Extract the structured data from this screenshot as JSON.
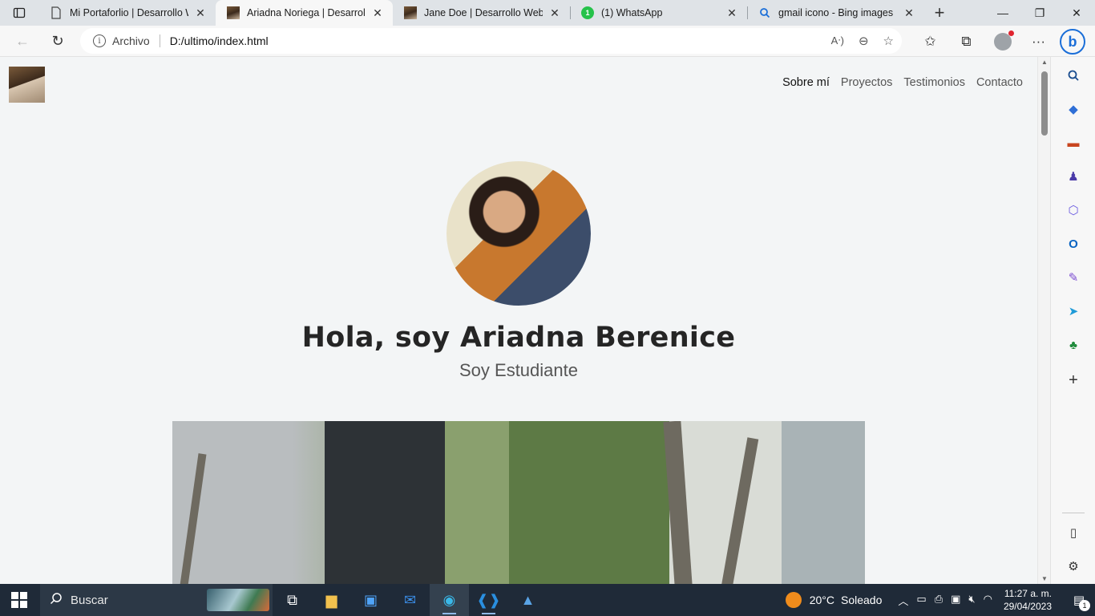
{
  "browser": {
    "tabs": [
      {
        "title": "Mi Portaforlio | Desarrollo We",
        "favicon": "page-icon",
        "active": false
      },
      {
        "title": "Ariadna Noriega | Desarrollo",
        "favicon": "photo-favicon",
        "active": true
      },
      {
        "title": "Jane Doe | Desarrollo Web Fr",
        "favicon": "photo-favicon",
        "active": false
      },
      {
        "title": "(1) WhatsApp",
        "favicon": "whatsapp-icon",
        "badge": "1",
        "active": false
      },
      {
        "title": "gmail icono - Bing images",
        "favicon": "search-icon",
        "active": false
      }
    ],
    "address": {
      "scheme_label": "Archivo",
      "url": "D:/ultimo/index.html"
    }
  },
  "page": {
    "nav": {
      "about": "Sobre mí",
      "projects": "Proyectos",
      "testimonials": "Testimonios",
      "contact": "Contacto"
    },
    "hero": {
      "title": "Hola, soy Ariadna Berenice",
      "subtitle": "Soy Estudiante"
    }
  },
  "taskbar": {
    "search_placeholder": "Buscar",
    "weather": {
      "temp": "20°C",
      "condition": "Soleado"
    },
    "clock": {
      "time": "11:27 a. m.",
      "date": "29/04/2023"
    },
    "notifications": "1"
  },
  "colors": {
    "page_bg": "#f3f5f6",
    "taskbar_bg": "#1f2a38",
    "edge_accent": "#1a6ed8"
  }
}
